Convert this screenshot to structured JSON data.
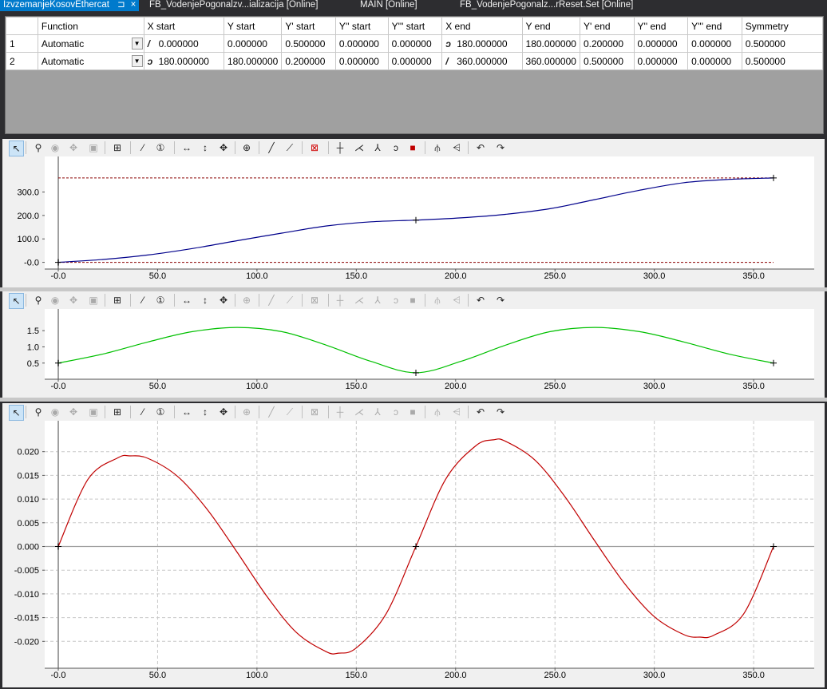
{
  "tabs": [
    {
      "label": "IzvzemanjeKosovEthercat",
      "active": true,
      "pin": "⊐",
      "close": "×"
    },
    {
      "label": "FB_VodenjePogonalzv...ializacija [Online]"
    },
    {
      "label": "MAIN [Online]"
    },
    {
      "label": "FB_VodenjePogonalz...rReset.Set [Online]"
    }
  ],
  "table": {
    "columns": [
      "",
      "Function",
      "X start",
      "Y start",
      "Y' start",
      "Y'' start",
      "Y''' start",
      "X end",
      "Y end",
      "Y' end",
      "Y'' end",
      "Y''' end",
      "Symmetry"
    ],
    "rows": [
      {
        "n": "1",
        "function": "Automatic",
        "x_start": "0.000000",
        "x_start_icon": "slope-up-icon",
        "y_start": "0.000000",
        "y1_start": "0.500000",
        "y2_start": "0.000000",
        "y3_start": "0.000000",
        "x_end": "180.000000",
        "x_end_icon": "curve-icon",
        "y_end": "180.000000",
        "y1_end": "0.200000",
        "y2_end": "0.000000",
        "y3_end": "0.000000",
        "symmetry": "0.500000"
      },
      {
        "n": "2",
        "function": "Automatic",
        "x_start": "180.000000",
        "x_start_icon": "curve-icon",
        "y_start": "180.000000",
        "y1_start": "0.200000",
        "y2_start": "0.000000",
        "y3_start": "0.000000",
        "x_end": "360.000000",
        "x_end_icon": "slope-up-icon",
        "y_end": "360.000000",
        "y1_end": "0.500000",
        "y2_end": "0.000000",
        "y3_end": "0.000000",
        "symmetry": "0.500000"
      }
    ]
  },
  "toolbar_icons": [
    "pointer-icon",
    "zoom-icon",
    "zoom-area-icon",
    "pan-icon",
    "print-icon",
    "grid-icon",
    "select-line-icon",
    "number-one-icon",
    "horizontal-move-icon",
    "vertical-move-icon",
    "move-all-icon",
    "target-icon",
    "line-icon",
    "polyline-icon",
    "delete-point-icon",
    "insert-point-icon",
    "split-icon",
    "merge-icon",
    "smooth-icon",
    "stop-icon",
    "mirror-icon",
    "fit-icon",
    "undo-icon",
    "redo-icon"
  ],
  "colors": {
    "position": "#00008b",
    "velocity": "#00c000",
    "acceleration": "#c00000",
    "limit": "#8b0000",
    "tab_active": "#007acc"
  },
  "chart_data": [
    {
      "type": "line",
      "title": "",
      "xlabel": "",
      "ylabel": "",
      "xlim": [
        0,
        360
      ],
      "ylim": [
        -15,
        380
      ],
      "x_ticks": [
        "-0.0",
        "50.0",
        "100.0",
        "150.0",
        "200.0",
        "250.0",
        "300.0",
        "350.0"
      ],
      "y_ticks": [
        "-0.0",
        "100.0",
        "200.0",
        "300.0"
      ],
      "limit_lines": [
        0,
        360
      ],
      "series": [
        {
          "x": [
            0,
            22.5,
            45,
            67.5,
            90,
            112.5,
            135,
            157.5,
            180,
            202.5,
            225,
            247.5,
            270,
            292.5,
            315,
            337.5,
            360
          ],
          "y": [
            0,
            12.3,
            31.3,
            58.8,
            92.4,
            124.6,
            155.2,
            172.9,
            180,
            189.5,
            204.8,
            228.9,
            267.6,
            307.5,
            339.7,
            353.7,
            360
          ]
        }
      ],
      "markers": [
        [
          0,
          0
        ],
        [
          180,
          180
        ],
        [
          360,
          360
        ]
      ],
      "grid": false
    },
    {
      "type": "line",
      "title": "",
      "xlabel": "",
      "ylabel": "",
      "xlim": [
        0,
        360
      ],
      "ylim": [
        0.1,
        1.8
      ],
      "x_ticks": [
        "-0.0",
        "50.0",
        "100.0",
        "150.0",
        "200.0",
        "250.0",
        "300.0",
        "350.0"
      ],
      "y_ticks": [
        "0.5",
        "1.0",
        "1.5"
      ],
      "series": [
        {
          "x": [
            0,
            22.5,
            45,
            67.5,
            90,
            112.5,
            135,
            157.5,
            180,
            202.5,
            225,
            247.5,
            270,
            292.5,
            315,
            337.5,
            360
          ],
          "y": [
            0.5,
            0.78,
            1.15,
            1.47,
            1.6,
            1.47,
            1.05,
            0.55,
            0.2,
            0.55,
            1.05,
            1.47,
            1.6,
            1.47,
            1.15,
            0.78,
            0.5
          ]
        }
      ],
      "markers": [
        [
          0,
          0.5
        ],
        [
          180,
          0.2
        ],
        [
          360,
          0.5
        ]
      ],
      "grid": false
    },
    {
      "type": "line",
      "title": "",
      "xlabel": "",
      "ylabel": "",
      "xlim": [
        0,
        360
      ],
      "ylim": [
        -0.025,
        0.025
      ],
      "x_ticks": [
        "-0.0",
        "50.0",
        "100.0",
        "150.0",
        "200.0",
        "250.0",
        "300.0",
        "350.0"
      ],
      "y_ticks": [
        "0.020",
        "0.015",
        "0.010",
        "0.005",
        "0.000",
        "-0.005",
        "-0.010",
        "-0.015",
        "-0.020"
      ],
      "series": [
        {
          "x": [
            0,
            15,
            30,
            36,
            45,
            60,
            75,
            90,
            105,
            120,
            135,
            141,
            150,
            165,
            180,
            195,
            210,
            219,
            225,
            240,
            255,
            270,
            285,
            300,
            315,
            323,
            330,
            345,
            360
          ],
          "y": [
            0,
            0.0142,
            0.0187,
            0.0191,
            0.0186,
            0.0148,
            0.0078,
            -0.0012,
            -0.0105,
            -0.0182,
            -0.0222,
            -0.0225,
            -0.0214,
            -0.0142,
            0,
            0.0142,
            0.0212,
            0.0225,
            0.0222,
            0.0182,
            0.0105,
            0.0012,
            -0.0078,
            -0.0148,
            -0.0186,
            -0.0191,
            -0.0187,
            -0.0142,
            0
          ]
        }
      ],
      "markers": [
        [
          0,
          0
        ],
        [
          180,
          0
        ],
        [
          360,
          0
        ]
      ],
      "grid": true
    }
  ]
}
